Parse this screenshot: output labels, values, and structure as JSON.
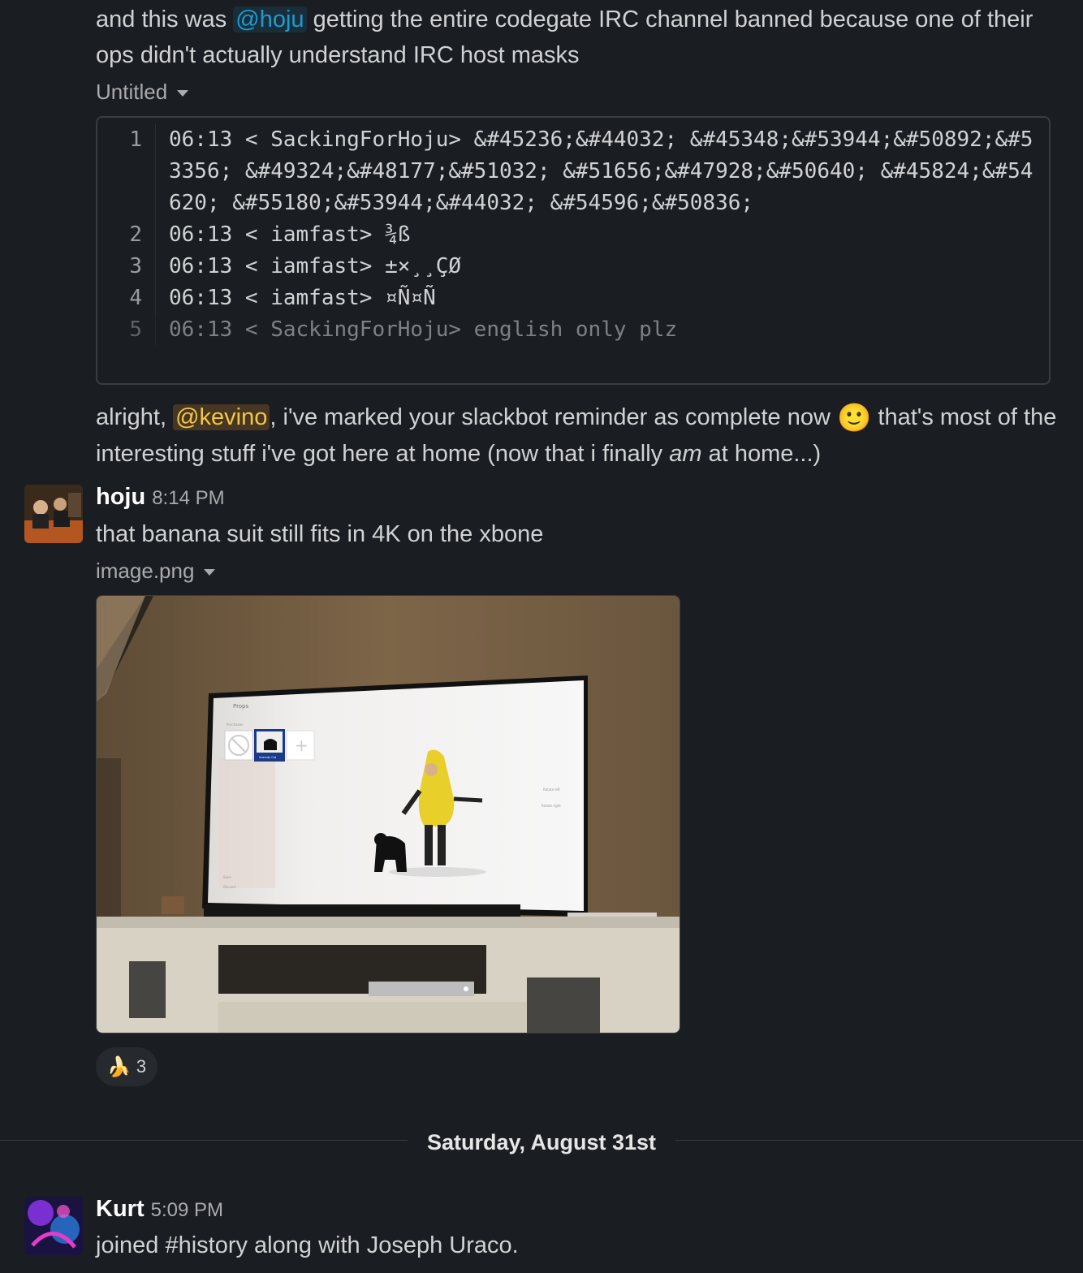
{
  "message1": {
    "prefix": "and this was",
    "mention": "@hoju",
    "suffix": "getting the entire codegate IRC channel banned because one of their ops didn't actually understand IRC host masks"
  },
  "snippet": {
    "filename": "Untitled",
    "lines": [
      {
        "num": "1",
        "text": "06:13 < SackingForHoju> &#45236;&#44032; &#45348;&#53944;&#50892;&#53356; &#49324;&#48177;&#51032; &#51656;&#47928;&#50640; &#45824;&#54620; &#55180;&#53944;&#44032; &#54596;&#50836;"
      },
      {
        "num": "2",
        "text": "06:13 < iamfast> ¾ß"
      },
      {
        "num": "3",
        "text": "06:13 < iamfast> ±×¸¸ÇØ"
      },
      {
        "num": "4",
        "text": "06:13 < iamfast> ¤Ñ¤Ñ"
      },
      {
        "num": "5",
        "text": "06:13 < SackingForHoju> english only plz"
      }
    ]
  },
  "message2": {
    "prefix": "alright,",
    "mention": "@kevino",
    "middle": ", i've marked your slackbot reminder as complete now",
    "emoji": "🙂",
    "suffix1": "that's most of the interesting stuff i've got here at home (now that i finally",
    "italic": "am",
    "suffix2": "at home...)"
  },
  "post_hoju": {
    "author": "hoju",
    "time": "8:14 PM",
    "text": "that banana suit still fits in 4K on the xbone",
    "attachment_name": "image.png",
    "image_alt": "Photo of TV showing Xbox avatar in banana suit with a cat",
    "tv_ui": {
      "header": "Props",
      "section": "Purchases",
      "item_label": "Scaredy Cat",
      "rotate_left": "Rotate left",
      "rotate_right": "Rotate right",
      "save": "Save",
      "discard": "Discard"
    },
    "reaction": {
      "emoji": "🍌",
      "count": "3"
    }
  },
  "date_divider": "Saturday, August 31st",
  "post_kurt": {
    "author": "Kurt",
    "time": "5:09 PM",
    "text": "joined #history along with Joseph Uraco."
  },
  "colors": {
    "background": "#1a1d21",
    "mention_blue": "#1d9bd1",
    "mention_yellow": "#f2c744"
  }
}
